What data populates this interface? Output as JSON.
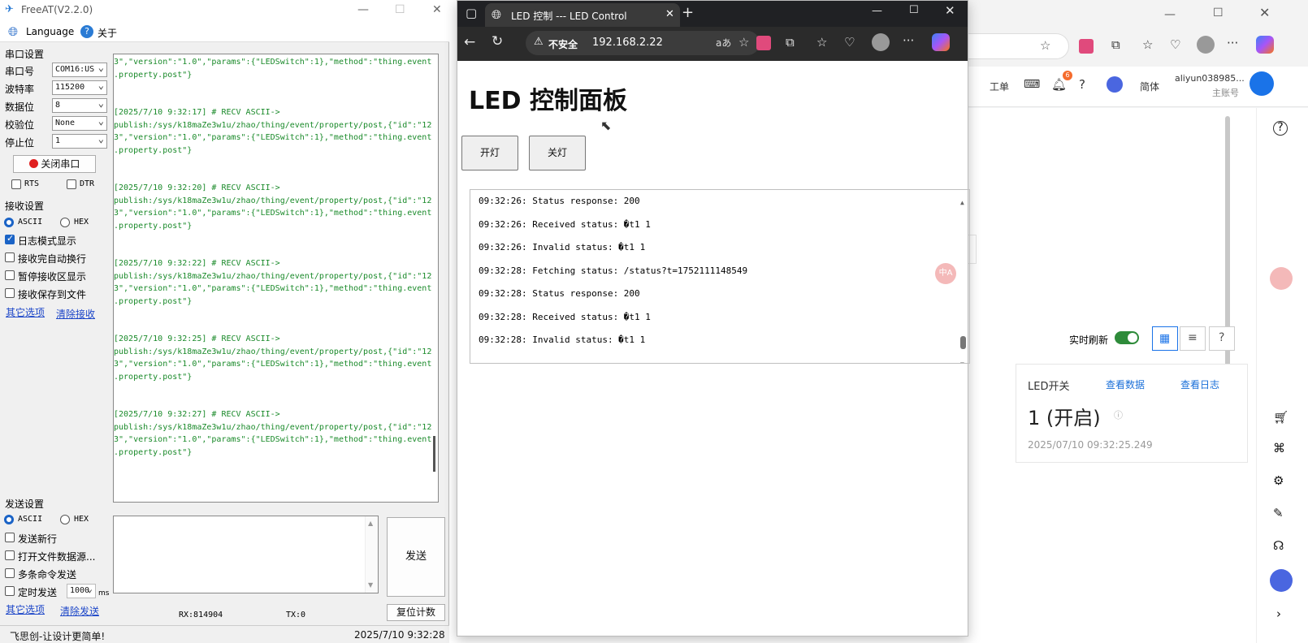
{
  "freeat": {
    "title": "FreeAT(V2.2.0)",
    "language": "Language",
    "about": "关于",
    "serial_section": "串口设置",
    "port_label": "串口号",
    "port_value": "COM16:US",
    "baud_label": "波特率",
    "baud_value": "115200",
    "data_label": "数据位",
    "data_value": "8",
    "parity_label": "校验位",
    "parity_value": "None",
    "stop_label": "停止位",
    "stop_value": "1",
    "close_port": "关闭串口",
    "rts": "RTS",
    "dtr": "DTR",
    "recv_section": "接收设置",
    "ascii": "ASCII",
    "hex": "HEX",
    "log_mode": "日志模式显示",
    "auto_newline": "接收完自动换行",
    "pause_display": "暂停接收区显示",
    "save_file": "接收保存到文件",
    "other_options": "其它选项",
    "clear_recv": "清除接收",
    "recv_lines": [
      "3\",\"version\":\"1.0\",\"params\":{\"LEDSwitch\":1},\"method\":\"thing.event",
      ".property.post\"}",
      "",
      "",
      "[2025/7/10 9:32:17] # RECV ASCII->",
      "publish:/sys/k18maZe3w1u/zhao/thing/event/property/post,{\"id\":\"12",
      "3\",\"version\":\"1.0\",\"params\":{\"LEDSwitch\":1},\"method\":\"thing.event",
      ".property.post\"}",
      "",
      "",
      "[2025/7/10 9:32:20] # RECV ASCII->",
      "publish:/sys/k18maZe3w1u/zhao/thing/event/property/post,{\"id\":\"12",
      "3\",\"version\":\"1.0\",\"params\":{\"LEDSwitch\":1},\"method\":\"thing.event",
      ".property.post\"}",
      "",
      "",
      "[2025/7/10 9:32:22] # RECV ASCII->",
      "publish:/sys/k18maZe3w1u/zhao/thing/event/property/post,{\"id\":\"12",
      "3\",\"version\":\"1.0\",\"params\":{\"LEDSwitch\":1},\"method\":\"thing.event",
      ".property.post\"}",
      "",
      "",
      "[2025/7/10 9:32:25] # RECV ASCII->",
      "publish:/sys/k18maZe3w1u/zhao/thing/event/property/post,{\"id\":\"12",
      "3\",\"version\":\"1.0\",\"params\":{\"LEDSwitch\":1},\"method\":\"thing.event",
      ".property.post\"}",
      "",
      "",
      "[2025/7/10 9:32:27] # RECV ASCII->",
      "publish:/sys/k18maZe3w1u/zhao/thing/event/property/post,{\"id\":\"12",
      "3\",\"version\":\"1.0\",\"params\":{\"LEDSwitch\":1},\"method\":\"thing.event",
      ".property.post\"}"
    ],
    "send_section": "发送设置",
    "send_newline": "发送新行",
    "open_file": "打开文件数据源...",
    "multi_cmd": "多条命令发送",
    "timed_send": "定时发送",
    "interval": "1000",
    "ms": "ms",
    "send_btn": "发送",
    "other_options2": "其它选项",
    "clear_send": "清除发送",
    "rx": "RX:814904",
    "tx": "TX:0",
    "reset_count": "复位计数",
    "slogan": "飞思创-让设计更简单!",
    "datetime": "2025/7/10 9:32:28"
  },
  "edge": {
    "tab_title": "LED 控制 --- LED Control",
    "insecure": "不安全",
    "url": "192.168.2.22",
    "heading": "LED 控制面板",
    "on_btn": "开灯",
    "off_btn": "关灯",
    "log": [
      "09:32:26: Status response: 200",
      "09:32:26: Received status: �t1 1",
      "09:32:26: Invalid status: �t1 1",
      "09:32:28: Fetching status: /status?t=1752111148549",
      "09:32:28: Status response: 200",
      "09:32:28: Received status: �t1 1",
      "09:32:28: Invalid status: �t1 1"
    ]
  },
  "aliyun": {
    "menu_ticket": "工单",
    "notif_count": "6",
    "lang": "简体",
    "account": "aliyun038985...",
    "account_sub": "主账号",
    "realtime": "实时刷新",
    "card_title": "LED开关",
    "view_data": "查看数据",
    "view_log": "查看日志",
    "value": "1 (开启)",
    "timestamp": "2025/07/10 09:32:25.249"
  }
}
